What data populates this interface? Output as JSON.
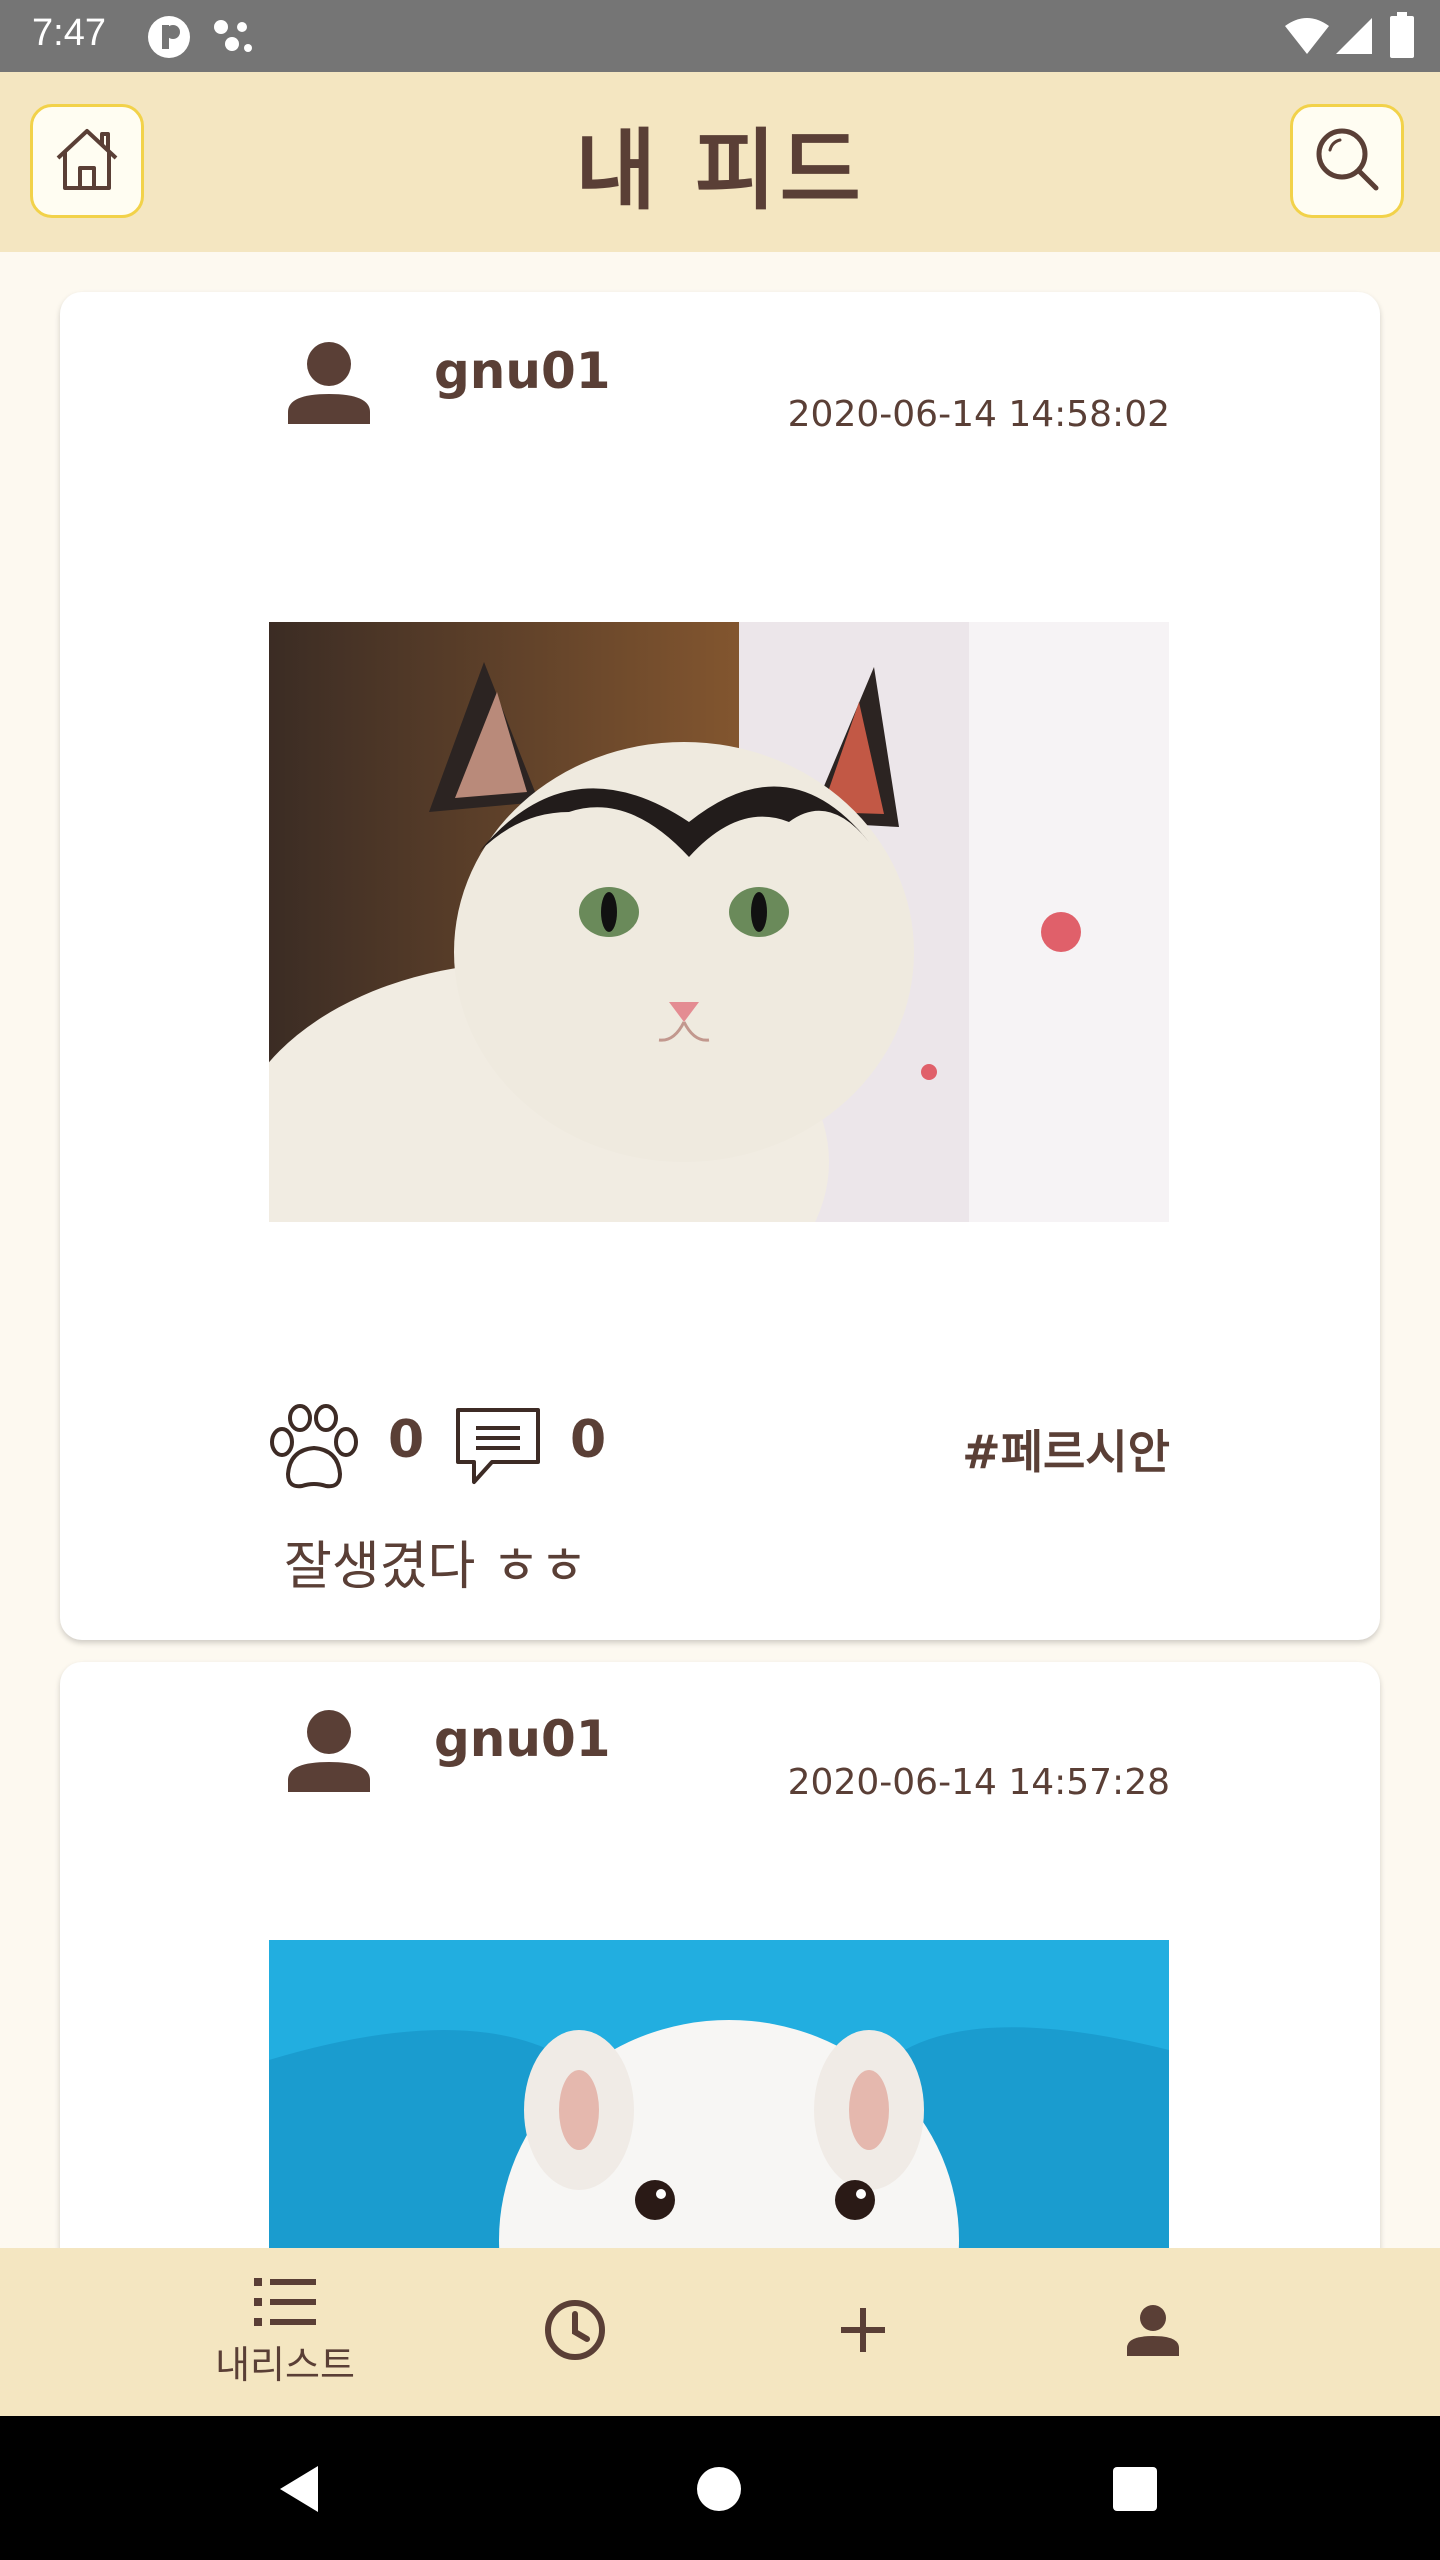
{
  "status_bar": {
    "time": "7:47",
    "icons": [
      "p-app-icon",
      "dots-app-icon",
      "wifi-icon",
      "signal-icon",
      "battery-icon"
    ]
  },
  "header": {
    "title": "내 피드",
    "left_icon": "home-icon",
    "right_icon": "search-icon"
  },
  "posts": [
    {
      "username": "gnu01",
      "timestamp": "2020-06-14 14:58:02",
      "photo": "white-black-cat-photo",
      "likes": "0",
      "comments": "0",
      "tag": "#페르시안",
      "caption": "잘생겼다 ㅎㅎ"
    },
    {
      "username": "gnu01",
      "timestamp": "2020-06-14 14:57:28",
      "photo": "white-puppy-photo"
    }
  ],
  "bottom_nav": {
    "items": [
      {
        "icon": "list-icon",
        "label": "내리스트"
      },
      {
        "icon": "clock-icon",
        "label": ""
      },
      {
        "icon": "plus-icon",
        "label": ""
      },
      {
        "icon": "person-icon",
        "label": ""
      }
    ]
  },
  "colors": {
    "header_bg": "#f4e6c1",
    "accent_border": "#f2d24a",
    "text_brown": "#5a3f36",
    "page_bg": "#fdf9f0"
  }
}
